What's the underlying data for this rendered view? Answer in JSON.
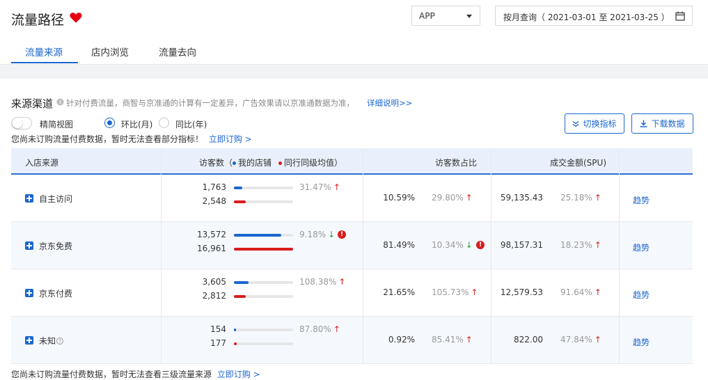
{
  "header": {
    "title": "流量路径",
    "tabs": [
      "流量来源",
      "店内浏览",
      "流量去向"
    ],
    "platform_select": "APP",
    "date_range": "按月查询（ 2021-03-01 至 2021-03-25 ）"
  },
  "section": {
    "title": "来源渠道",
    "note": "针对付费流量，商智与京准通的计算有一定差异，广告效果请以京准通数据为准，",
    "note_link": "详细说明>>",
    "toggle_label": "精简视图",
    "radio_options": [
      "环比(月)",
      "同比(年)"
    ],
    "notice_top": "您尚未订购流量付费数据，暂时无法查看部分指标！",
    "notice_top_link": "立即订购 >",
    "btn_switch": "切换指标",
    "btn_download": "下载数据",
    "notice_bottom": "您尚未订购流量付费数据，暂时无法查看三级流量来源",
    "notice_bottom_link": "立即订购 >"
  },
  "table": {
    "headers": {
      "source": "入店来源",
      "visitors": "访客数（",
      "legend_my": "我的店铺",
      "legend_peer": "同行同级均值",
      "visitors_close": "）",
      "share": "访客数占比",
      "sales": "成交金额(SPU)"
    },
    "legend_colors": {
      "my": "#1a66cf",
      "peer": "#d91c1c"
    },
    "rows": [
      {
        "name": "自主访问",
        "help": false,
        "my": "1,763",
        "peer": "2,548",
        "my_ratio": 0.14,
        "peer_ratio": 0.2,
        "visit_change": "31.47%",
        "visit_dir": "up",
        "visit_warn": false,
        "share": "10.59%",
        "share_change": "29.80%",
        "share_dir": "up",
        "share_warn": false,
        "sales": "59,135.43",
        "sales_change": "25.18%",
        "sales_dir": "up",
        "trend": "趋势"
      },
      {
        "name": "京东免费",
        "help": false,
        "my": "13,572",
        "peer": "16,961",
        "my_ratio": 0.8,
        "peer_ratio": 1.0,
        "visit_change": "9.18%",
        "visit_dir": "down",
        "visit_warn": true,
        "share": "81.49%",
        "share_change": "10.34%",
        "share_dir": "down",
        "share_warn": true,
        "sales": "98,157.31",
        "sales_change": "18.23%",
        "sales_dir": "up",
        "trend": "趋势"
      },
      {
        "name": "京东付费",
        "help": false,
        "my": "3,605",
        "peer": "2,812",
        "my_ratio": 0.25,
        "peer_ratio": 0.2,
        "visit_change": "108.38%",
        "visit_dir": "up",
        "visit_warn": false,
        "share": "21.65%",
        "share_change": "105.73%",
        "share_dir": "up",
        "share_warn": false,
        "sales": "12,579.53",
        "sales_change": "91.64%",
        "sales_dir": "up",
        "trend": "趋势"
      },
      {
        "name": "未知",
        "help": true,
        "my": "154",
        "peer": "177",
        "my_ratio": 0.04,
        "peer_ratio": 0.05,
        "visit_change": "87.80%",
        "visit_dir": "up",
        "visit_warn": false,
        "share": "0.92%",
        "share_change": "85.41%",
        "share_dir": "up",
        "share_warn": false,
        "sales": "822.00",
        "sales_change": "47.84%",
        "sales_dir": "up",
        "trend": "趋势"
      }
    ]
  }
}
